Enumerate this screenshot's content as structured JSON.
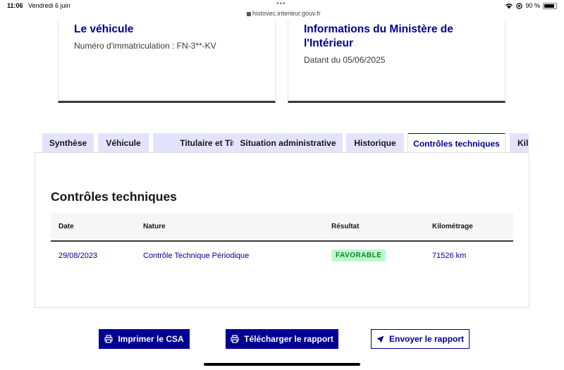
{
  "status_bar": {
    "time": "11:06",
    "date": "Vendredi 6 juin",
    "dots": "•••",
    "url": "histovec.interieur.gouv.fr",
    "battery": "90 %"
  },
  "cards": {
    "vehicle": {
      "title": "Le véhicule",
      "plate_text": "Numéro d'immatriculation : FN-3**-KV"
    },
    "ministry": {
      "title": "Informations du Ministère de l'Intérieur",
      "date_text": "Datant du 05/06/2025"
    }
  },
  "tabs": [
    {
      "label": "Synthèse"
    },
    {
      "label": "Véhicule"
    },
    {
      "label": "Titulaire et Titre"
    },
    {
      "label": "Situation administrative"
    },
    {
      "label": "Historique"
    },
    {
      "label": "Contrôles techniques"
    },
    {
      "label": "Kilométrage"
    }
  ],
  "panel": {
    "title": "Contrôles techniques",
    "columns": [
      "Date",
      "Nature",
      "Résultat",
      "Kilométrage"
    ],
    "rows": [
      {
        "date": "29/08/2023",
        "nature": "Contrôle Technique Périodique",
        "result": "FAVORABLE",
        "km": "71526 km"
      }
    ]
  },
  "buttons": {
    "print": "Imprimer le CSA",
    "download": "Télécharger le rapport",
    "send": "Envoyer le rapport"
  },
  "colors": {
    "primary": "#000091",
    "tab_bg": "#e3e3fd",
    "badge_bg": "#b8fec9",
    "badge_text": "#18753c"
  }
}
